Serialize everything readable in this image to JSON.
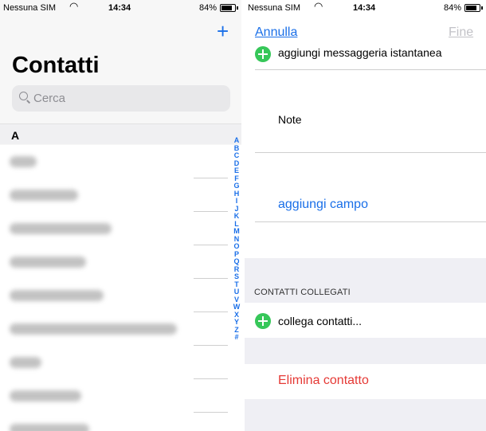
{
  "left_screen": {
    "status_bar": {
      "carrier": "Nessuna SIM",
      "time": "14:34",
      "battery": "84%"
    },
    "add_icon": "+",
    "title": "Contatti",
    "search": {
      "placeholder": "Cerca"
    },
    "section_letter": "A",
    "alphabet_index": [
      "A",
      "B",
      "C",
      "D",
      "E",
      "F",
      "G",
      "H",
      "I",
      "J",
      "K",
      "L",
      "M",
      "N",
      "O",
      "P",
      "Q",
      "R",
      "S",
      "T",
      "U",
      "V",
      "W",
      "X",
      "Y",
      "Z",
      "#"
    ]
  },
  "right_screen": {
    "status_bar": {
      "carrier": "Nessuna SIM",
      "time": "14:34",
      "battery": "84%"
    },
    "cancel_label": "Annulla",
    "done_label": "Fine",
    "add_im_label": "aggiungi messaggeria istantanea",
    "notes_label": "Note",
    "add_field_label": "aggiungi campo",
    "linked_contacts_header": "CONTATTI COLLEGATI",
    "link_contacts_label": "collega contatti...",
    "delete_contact_label": "Elimina contatto"
  },
  "colors": {
    "accent": "#1a6fe8",
    "add_green": "#36c759",
    "destructive": "#e53935",
    "disabled": "#c2c2c7"
  }
}
